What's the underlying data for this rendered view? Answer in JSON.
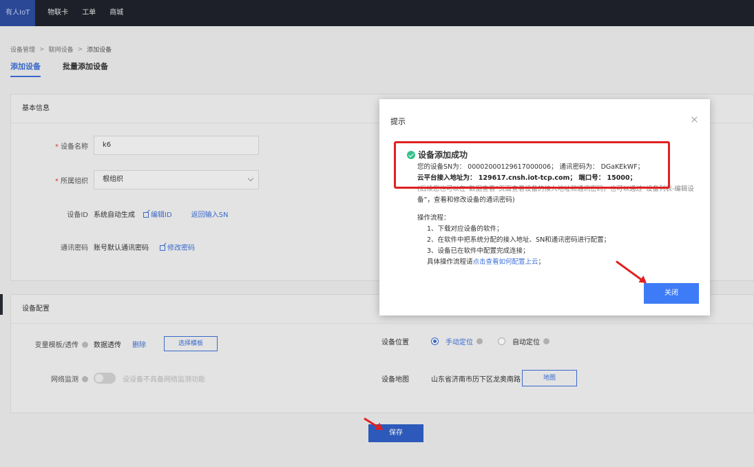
{
  "topnav": {
    "items": [
      {
        "label": "有人IoT",
        "active": true
      },
      {
        "label": "物联卡",
        "active": false
      },
      {
        "label": "工单",
        "active": false
      },
      {
        "label": "商城",
        "active": false
      }
    ]
  },
  "breadcrumb": {
    "items": [
      "设备管理",
      "联网设备",
      "添加设备"
    ],
    "separator": ">"
  },
  "tabs": [
    "添加设备",
    "批量添加设备"
  ],
  "basic": {
    "title": "基本信息",
    "device_name_label": "设备名称",
    "device_name_value": "k6",
    "org_label": "所属组织",
    "org_value": "根组织",
    "id_label": "设备ID",
    "id_value": "系统自动生成",
    "edit_id": "编辑ID",
    "back_sn": "返回输入SN",
    "pwd_label": "通讯密码",
    "pwd_value": "账号默认通讯密码",
    "edit_pwd": "修改密码"
  },
  "config": {
    "title": "设备配置",
    "template_label": "变量模板/透传",
    "template_value": "数据透传",
    "delete": "删除",
    "select_template": "选择模板",
    "net_label": "网络监测",
    "net_hint": "设设备不具备网络监测功能",
    "location_label": "设备位置",
    "manual": "手动定位",
    "auto": "自动定位",
    "map_label": "设备地图",
    "address": "山东省济南市历下区龙奥南路",
    "map_btn": "地图"
  },
  "save": "保存",
  "dialog": {
    "title": "提示",
    "success_title": "设备添加成功",
    "sn_line": "您的设备SN为： 00002000129617000006； 通讯密码为： DGaKEkWF；",
    "cloud_line": "云平台接入地址为： 129617.cnsh.iot-tcp.com； 端口号： 15000；",
    "note_line1": "(后续您也可以在“数据查看”页面查看设备的接入地址和通讯密码，也可以通过“设备列表-编辑设",
    "note_line2": "备”，查看和修改设备的通讯密码)",
    "steps_title": "操作流程：",
    "step1": "1、下载对应设备的软件；",
    "step2": "2、在软件中把系统分配的接入地址、SN和通讯密码进行配置；",
    "step3": "3、设备已在软件中配置完成连接；",
    "step4_prefix": "具体操作流程请",
    "step4_link": "点击查看如何配置上云",
    "step4_suffix": "；",
    "close": "关闭"
  },
  "colors": {
    "accent": "#3d6fd8",
    "success": "#34c08a",
    "annotation": "#e02020",
    "nav_bg": "#20222c"
  }
}
